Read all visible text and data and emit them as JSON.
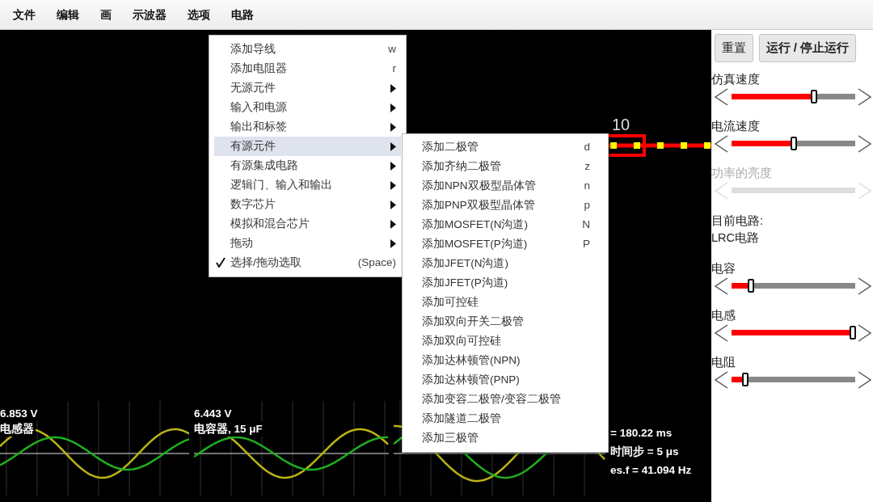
{
  "menubar": [
    {
      "label": "文件"
    },
    {
      "label": "编辑"
    },
    {
      "label": "画"
    },
    {
      "label": "示波器"
    },
    {
      "label": "选项"
    },
    {
      "label": "电路"
    }
  ],
  "menu": {
    "items": [
      {
        "label": "添加导线",
        "shortcut": "w",
        "kind": "action",
        "selected": false,
        "checked": false
      },
      {
        "label": "添加电阻器",
        "shortcut": "r",
        "kind": "action",
        "selected": false,
        "checked": false
      },
      {
        "label": "无源元件",
        "kind": "submenu",
        "selected": false,
        "checked": false
      },
      {
        "label": "输入和电源",
        "kind": "submenu",
        "selected": false,
        "checked": false
      },
      {
        "label": "输出和标签",
        "kind": "submenu",
        "selected": false,
        "checked": false
      },
      {
        "label": "有源元件",
        "kind": "submenu",
        "selected": true,
        "checked": false
      },
      {
        "label": "有源集成电路",
        "kind": "submenu",
        "selected": false,
        "checked": false
      },
      {
        "label": "逻辑门、输入和输出",
        "kind": "submenu",
        "selected": false,
        "checked": false
      },
      {
        "label": "数字芯片",
        "kind": "submenu",
        "selected": false,
        "checked": false
      },
      {
        "label": "模拟和混合芯片",
        "kind": "submenu",
        "selected": false,
        "checked": false
      },
      {
        "label": "拖动",
        "kind": "submenu",
        "selected": false,
        "checked": false
      },
      {
        "label": "选择/拖动选取",
        "shortcut": "(Space)",
        "kind": "action",
        "selected": false,
        "checked": true
      }
    ]
  },
  "submenu": {
    "items": [
      {
        "label": "添加二极管",
        "shortcut": "d"
      },
      {
        "label": "添加齐纳二极管",
        "shortcut": "z"
      },
      {
        "label": "添加NPN双极型晶体管",
        "shortcut": "n"
      },
      {
        "label": "添加PNP双极型晶体管",
        "shortcut": "p"
      },
      {
        "label": "添加MOSFET(N沟道)",
        "shortcut": "N"
      },
      {
        "label": "添加MOSFET(P沟道)",
        "shortcut": "P"
      },
      {
        "label": "添加JFET(N沟道)"
      },
      {
        "label": "添加JFET(P沟道)"
      },
      {
        "label": "添加可控硅"
      },
      {
        "label": "添加双向开关二极管"
      },
      {
        "label": "添加双向可控硅"
      },
      {
        "label": "添加达林顿管(NPN)"
      },
      {
        "label": "添加达林顿管(PNP)"
      },
      {
        "label": "添加变容二极管/变容二极管"
      },
      {
        "label": "添加隧道二极管"
      },
      {
        "label": "添加三极管"
      }
    ]
  },
  "circuit": {
    "resistor_label": "10"
  },
  "scopes": [
    {
      "kind": "scope",
      "value": "6.853 V",
      "label": "电感器"
    },
    {
      "kind": "scope",
      "value": "6.443 V",
      "label": "电容器, 15 μF"
    },
    {
      "kind": "scope"
    }
  ],
  "info_lines": [
    "= 180.22 ms",
    "时间步 = 5 μs",
    "es.f = 41.094 Hz"
  ],
  "panel": {
    "buttons": [
      "重置",
      "运行 / 停止运行"
    ],
    "items": [
      {
        "kind": "slider",
        "label": "仿真速度",
        "level": 0.67,
        "disabled": false
      },
      {
        "kind": "slider",
        "label": "电流速度",
        "level": 0.5,
        "disabled": false
      },
      {
        "kind": "slider",
        "label": "功率的亮度",
        "disabled": true
      },
      {
        "kind": "text",
        "label": "目前电路:"
      },
      {
        "kind": "text",
        "label": "LRC电路"
      },
      {
        "kind": "slider",
        "label": "电容",
        "level": 0.14,
        "disabled": false
      },
      {
        "kind": "slider",
        "label": "电感",
        "level": 1.0,
        "disabled": false
      },
      {
        "kind": "slider",
        "label": "电阻",
        "level": 0.09,
        "disabled": false
      }
    ]
  }
}
